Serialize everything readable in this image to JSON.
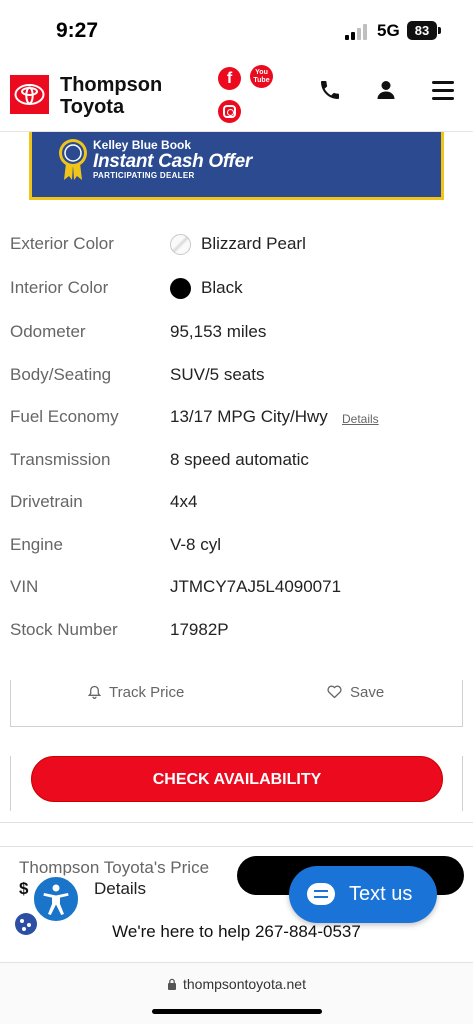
{
  "status_bar": {
    "time": "9:27",
    "network": "5G",
    "battery": "83"
  },
  "header": {
    "brand_line1": "Thompson",
    "brand_line2": "Toyota",
    "social": {
      "facebook": "f",
      "youtube_line1": "You",
      "youtube_line2": "Tube"
    },
    "icons": [
      "phone-icon",
      "user-icon",
      "menu-icon"
    ]
  },
  "kbb": {
    "line1": "Kelley Blue Book",
    "line2": "Instant Cash Offer",
    "line3": "PARTICIPATING DEALER"
  },
  "specs": [
    {
      "label": "Exterior Color",
      "value": "Blizzard Pearl",
      "swatch": "white"
    },
    {
      "label": "Interior Color",
      "value": "Black",
      "swatch": "black"
    },
    {
      "label": "Odometer",
      "value": "95,153 miles"
    },
    {
      "label": "Body/Seating",
      "value": "SUV/5 seats"
    },
    {
      "label": "Fuel Economy",
      "value": "13/17 MPG City/Hwy",
      "link": "Details"
    },
    {
      "label": "Transmission",
      "value": "8 speed automatic"
    },
    {
      "label": "Drivetrain",
      "value": "4x4"
    },
    {
      "label": "Engine",
      "value": "V-8 cyl"
    },
    {
      "label": "VIN",
      "value": "JTMCY7AJ5L4090071"
    },
    {
      "label": "Stock Number",
      "value": "17982P"
    }
  ],
  "actions": {
    "track_price": "Track Price",
    "save": "Save"
  },
  "cta": {
    "check_availability": "CHECK AVAILABILITY"
  },
  "sticky": {
    "price_label": "Thompson Toyota's Price",
    "price_value": "$",
    "details": "Details",
    "text_us": "Text us",
    "help": "We're here to help 267-884-0537"
  },
  "browser": {
    "url": "thompsontoyota.net"
  },
  "colors": {
    "brand_red": "#eb0a1e",
    "kbb_blue": "#2b4a8f",
    "kbb_gold": "#f0c419",
    "chat_blue": "#1a74d8"
  }
}
